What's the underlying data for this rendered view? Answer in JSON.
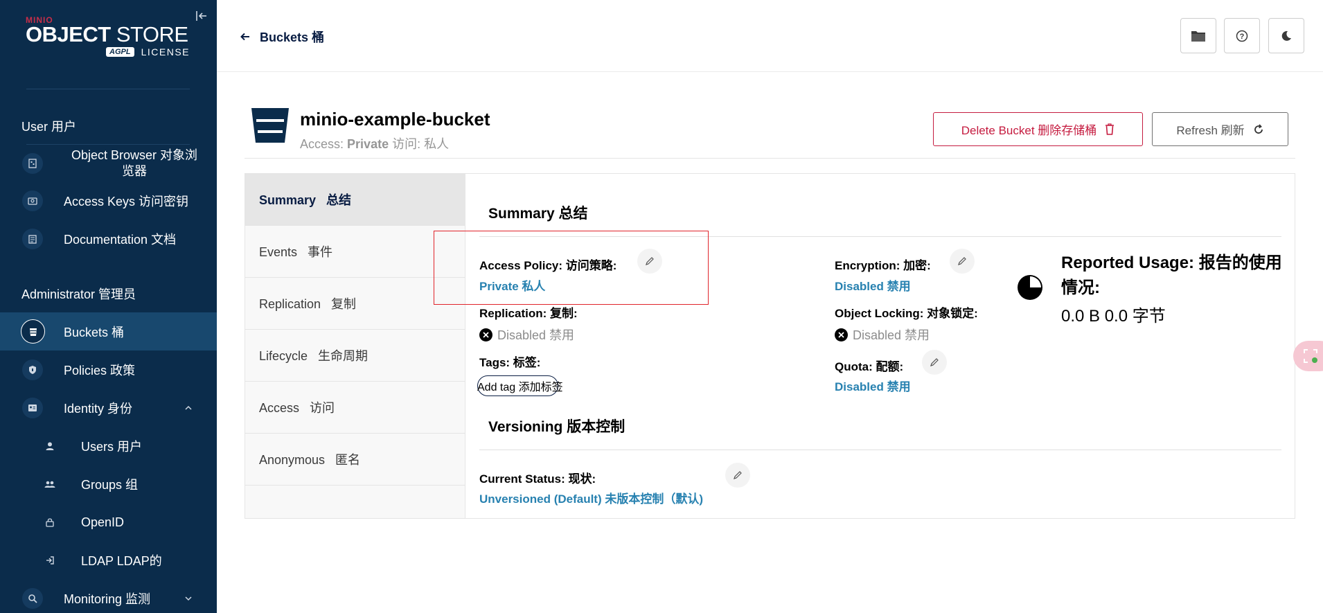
{
  "sidebar": {
    "logo": {
      "brand": "MINIO",
      "title_bold": "OBJECT",
      "title_light": " STORE",
      "badge": "AGPL",
      "license": "LICENSE"
    },
    "user_section": "User 用户",
    "admin_section": "Administrator 管理员",
    "items": [
      {
        "label": "Object Browser 对象浏览器",
        "icon": "object-browser-icon"
      },
      {
        "label": "Access Keys 访问密钥",
        "icon": "access-keys-icon"
      },
      {
        "label": "Documentation 文档",
        "icon": "documentation-icon"
      },
      {
        "label": "Buckets 桶",
        "icon": "bucket-icon",
        "active": true
      },
      {
        "label": "Policies 政策",
        "icon": "shield-icon"
      },
      {
        "label": "Identity 身份",
        "icon": "identity-icon"
      },
      {
        "label": "Users 用户",
        "icon": "user-icon"
      },
      {
        "label": "Groups 组",
        "icon": "groups-icon"
      },
      {
        "label": "OpenID",
        "icon": "lock-icon"
      },
      {
        "label": "LDAP LDAP的",
        "icon": "login-icon"
      },
      {
        "label": "Monitoring 监测",
        "icon": "monitoring-icon"
      }
    ]
  },
  "header": {
    "breadcrumb": "Buckets 桶"
  },
  "bucket": {
    "name": "minio-example-bucket",
    "access_prefix": "Access:",
    "access_value": "Private",
    "access_cn": "访问:  私人",
    "delete_label": "Delete Bucket 删除存储桶",
    "refresh_label": "Refresh 刷新"
  },
  "tabs": [
    {
      "label": "Summary   总结",
      "active": true
    },
    {
      "label": "Events   事件"
    },
    {
      "label": "Replication   复制"
    },
    {
      "label": "Lifecycle   生命周期"
    },
    {
      "label": "Access   访问"
    },
    {
      "label": "Anonymous   匿名"
    }
  ],
  "summary": {
    "title": "Summary 总结",
    "access_policy_label": "Access Policy: 访问策略:",
    "access_policy_value": "Private 私人",
    "replication_label": "Replication: 复制:",
    "replication_value": "Disabled 禁用",
    "tags_label": "Tags: 标签:",
    "add_tag": "Add tag 添加标签",
    "encryption_label": "Encryption: 加密:",
    "encryption_value": "Disabled 禁用",
    "object_locking_label": "Object Locking: 对象锁定:",
    "object_locking_value": "Disabled 禁用",
    "quota_label": "Quota: 配额:",
    "quota_value": "Disabled 禁用",
    "usage_title": "Reported Usage: 报告的使用情况:",
    "usage_value": "0.0 B 0.0 字节"
  },
  "versioning": {
    "title": "Versioning 版本控制",
    "status_label": "Current Status: 现状:",
    "status_value": "Unversioned (Default) 未版本控制（默认)"
  },
  "colors": {
    "sidebar_bg": "#0b2c4b",
    "accent_link": "#2781b0",
    "danger": "#c51b3f",
    "highlight": "#e0232a"
  }
}
